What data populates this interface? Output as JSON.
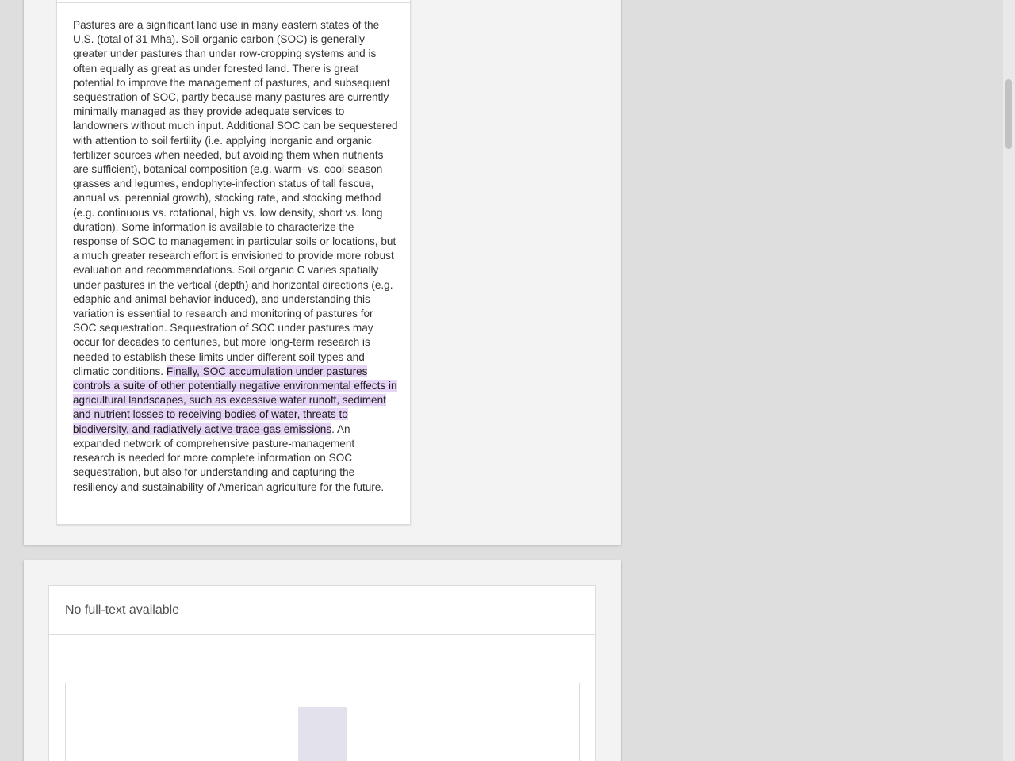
{
  "abstract": {
    "text_before": "Pastures are a significant land use in many eastern states of the U.S. (total of 31 Mha). Soil organic carbon (SOC) is generally greater under pastures than under row-cropping systems and is often equally as great as under forested land. There is great potential to improve the management of pastures, and subsequent sequestration of SOC, partly because many pastures are currently minimally managed as they provide adequate services to landowners without much input. Additional SOC can be sequestered with attention to soil fertility (i.e. applying inorganic and organic fertilizer sources when needed, but avoiding them when nutrients are sufficient), botanical composition (e.g. warm- vs. cool-season grasses and legumes, endophyte-infection status of tall fescue, annual vs. perennial growth), stocking rate, and stocking method (e.g. continuous vs. rotational, high vs. low density, short vs. long duration). Some information is available to characterize the response of SOC to management in particular soils or locations, but a much greater research effort is envisioned to provide more robust evaluation and recommendations. Soil organic C varies spatially under pastures in the vertical (depth) and horizontal directions (e.g. edaphic and animal behavior induced), and understanding this variation is essential to research and monitoring of pastures for SOC sequestration. Sequestration of SOC under pastures may occur for decades to centuries, but more long-term research is needed to establish these limits under different soil types and climatic conditions. ",
    "text_highlighted": "Finally, SOC accumulation under pastures controls a suite of other potentially negative environmental effects in agricultural landscapes, such as excessive water runoff, sediment and nutrient losses to receiving bodies of water, threats to biodiversity, and radiatively active trace-gas emissions",
    "text_after": ". An expanded network of comprehensive pasture-management research is needed for more complete information on SOC sequestration, but also for understanding and capturing the resiliency and sustainability of American agriculture for the future.",
    "highlight_color": "#e6d4f6"
  },
  "fulltext_panel": {
    "header": "No full-text available"
  },
  "colors": {
    "page_background": "#dedede",
    "card_background": "#f3f3f3",
    "panel_background": "#ffffff",
    "preview_thumb": "#e2e1ec"
  }
}
